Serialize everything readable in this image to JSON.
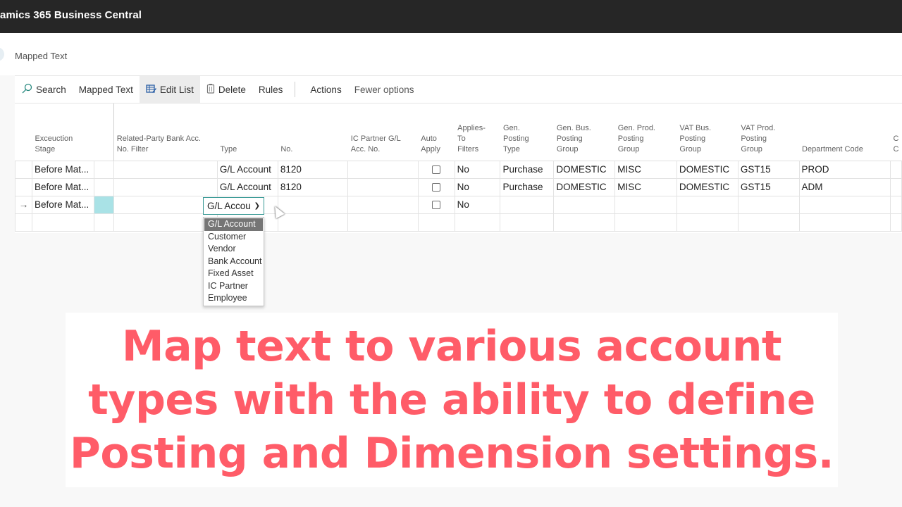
{
  "app": {
    "title": "amics 365 Business Central"
  },
  "page": {
    "title": "Mapped Text"
  },
  "actionbar": {
    "items": [
      {
        "label": "Search",
        "icon": "search-icon"
      },
      {
        "label": "Mapped Text"
      },
      {
        "label": "Edit List",
        "icon": "edit-list-icon",
        "active": true
      },
      {
        "label": "Delete",
        "icon": "delete-icon"
      },
      {
        "label": "Rules"
      },
      {
        "label": "Actions"
      },
      {
        "label": "Fewer options"
      }
    ]
  },
  "grid": {
    "columns": [
      "Exceuction\nStage",
      "Related-Party Bank Acc.\nNo. Filter",
      "Type",
      "No.",
      "IC Partner G/L\nAcc. No.",
      "Auto\nApply",
      "Applies-\nTo\nFilters",
      "Gen.\nPosting\nType",
      "Gen. Bus.\nPosting\nGroup",
      "Gen. Prod.\nPosting\nGroup",
      "VAT Bus.\nPosting\nGroup",
      "VAT Prod.\nPosting\nGroup",
      "Department Code",
      "C\nC"
    ],
    "rows": [
      {
        "indicator": "",
        "stage": "Before Mat...",
        "bank_filter": "",
        "type": "G/L Account",
        "no": "8120",
        "ic_partner": "",
        "auto_apply": false,
        "applies_to": "No",
        "gen_posting_type": "Purchase",
        "gen_bus": "DOMESTIC",
        "gen_prod": "MISC",
        "vat_bus": "DOMESTIC",
        "vat_prod": "GST15",
        "dept": "PROD"
      },
      {
        "indicator": "",
        "stage": "Before Mat...",
        "bank_filter": "",
        "type": "G/L Account",
        "no": "8120",
        "ic_partner": "",
        "auto_apply": false,
        "applies_to": "No",
        "gen_posting_type": "Purchase",
        "gen_bus": "DOMESTIC",
        "gen_prod": "MISC",
        "vat_bus": "DOMESTIC",
        "vat_prod": "GST15",
        "dept": "ADM"
      },
      {
        "indicator": "→",
        "stage": "Before Mat...",
        "bank_filter": "",
        "type": "G/L Accou",
        "no": "",
        "ic_partner": "",
        "auto_apply": false,
        "applies_to": "No",
        "gen_posting_type": "",
        "gen_bus": "",
        "gen_prod": "",
        "vat_bus": "",
        "vat_prod": "",
        "dept": ""
      }
    ]
  },
  "type_dropdown": {
    "selected": "G/L Accou",
    "options": [
      "G/L Account",
      "Customer",
      "Vendor",
      "Bank Account",
      "Fixed Asset",
      "IC Partner",
      "Employee"
    ],
    "highlighted": "G/L Account"
  },
  "caption": {
    "line1": "Map text to various account",
    "line2": "types with the ability to define",
    "line3": "Posting and Dimension settings."
  },
  "colors": {
    "caption": "#ff5c68",
    "link": "#00857a",
    "topbar": "#262626",
    "selected_cell": "#a9e2e6"
  }
}
